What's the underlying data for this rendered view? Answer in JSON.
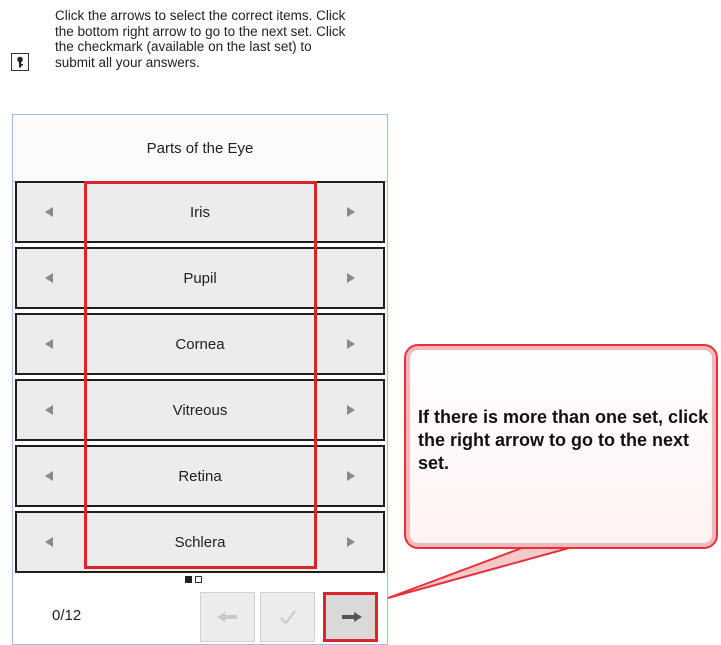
{
  "instructions": {
    "text": "Click the arrows to select the correct items. Click the bottom right arrow to go to the next set. Click the checkmark (available on the last set) to submit all your answers."
  },
  "panel": {
    "title": "Parts of the Eye",
    "items": [
      {
        "label": "Iris"
      },
      {
        "label": "Pupil"
      },
      {
        "label": "Cornea"
      },
      {
        "label": "Vitreous"
      },
      {
        "label": "Retina"
      },
      {
        "label": "Schlera"
      }
    ],
    "pager": {
      "total_sets": 2,
      "current_set": 1
    },
    "progress": "0/12"
  },
  "callout": {
    "text": "If there is more than one set, click the right arrow to go to the next set."
  },
  "colors": {
    "highlight": "#d9262b",
    "arrow": "#8a8a8a",
    "panel_border": "#9fbfe0",
    "row_bg": "#ececec"
  },
  "icons": {
    "key": "key-icon",
    "left": "arrow-left-icon",
    "right": "arrow-right-icon",
    "prev": "prev-arrow-icon",
    "check": "checkmark-icon",
    "next": "next-arrow-icon"
  }
}
